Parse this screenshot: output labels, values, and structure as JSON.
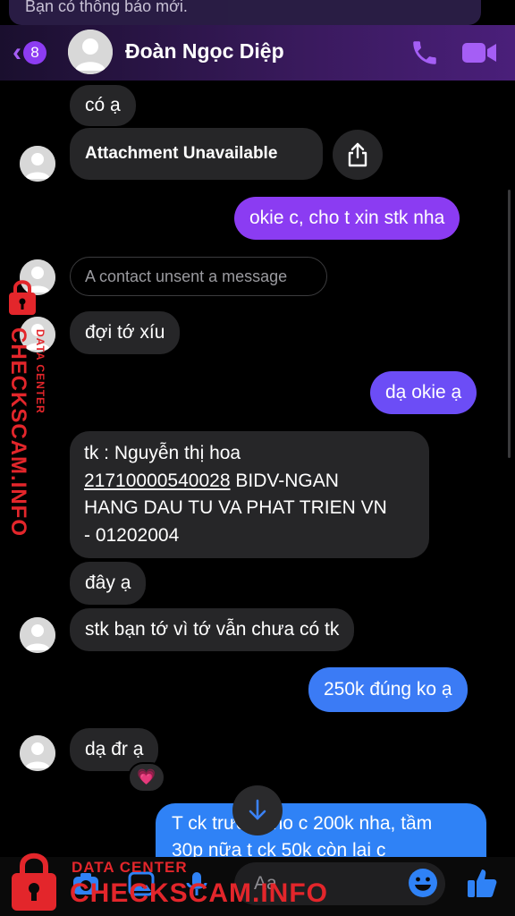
{
  "notification": {
    "text": "Bạn có thông báo mới."
  },
  "header": {
    "unread_count": "8",
    "contact_name": "Đoàn Ngọc Diệp"
  },
  "messages": {
    "m1": "có ạ",
    "m2_attachment": "Attachment Unavailable",
    "m3": "okie c, cho t xin stk nha",
    "m4_unsent": "A contact unsent a message",
    "m5": "đợi tớ xíu",
    "m6": "dạ okie ạ",
    "m7_line1": "tk : Nguyễn thị hoa",
    "m7_account": "21710000540028",
    "m7_line2_rest": " BIDV-NGAN",
    "m7_line3": "HANG DAU TU VA PHAT TRIEN VN",
    "m7_line4": "- 01202004",
    "m8": "đây ạ",
    "m9": "stk bạn tớ vì tớ vẫn chưa có tk",
    "m10": "250k đúng ko ạ",
    "m11": "dạ đr ạ",
    "m11_reaction": "💗",
    "m12_partial_line1": "T ck trước cho c 200k nha, tầm",
    "m12_partial_line2": "30p nữa t ck 50k còn lại c"
  },
  "composer": {
    "placeholder": "Aa"
  },
  "watermark": {
    "main": "CHECKSCAM.INFO",
    "sub": "DATA CENTER"
  },
  "colors": {
    "accent": "#8d3cf2",
    "outgoing_purple": "#8b3cf2",
    "outgoing_blue": "#2f82f6",
    "incoming": "#262628",
    "watermark": "#e3262b"
  }
}
